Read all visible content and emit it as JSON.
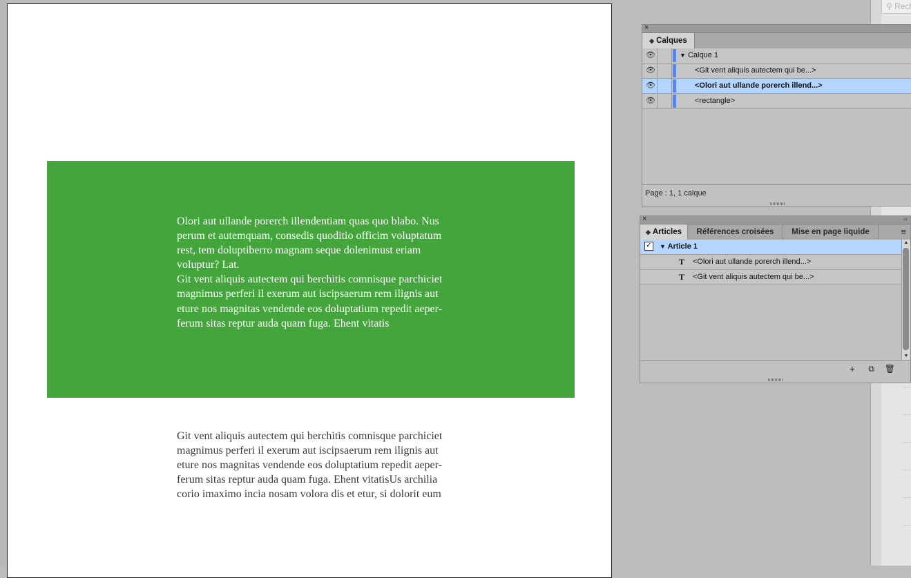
{
  "document": {
    "green_text": "Olori aut ullande porerch illendentiam quas quo blabo. Nus\nperum et autemquam, consedis quoditio officim voluptatum\nrest, tem doluptiberro magnam seque dolenimust eriam\nvoluptur? Lat.\nGit vent aliquis autectem qui berchitis comnisque parchiciet\nmagnimus perferi il exerum aut iscipsaerum rem ilignis aut\neture nos magnitas vendende eos doluptatium repedit aeper-\nferum sitas reptur auda quam fuga. Ehent vitatis",
    "below_text": "Git vent aliquis autectem qui berchitis comnisque parchiciet\nmagnimus perferi il exerum aut iscipsaerum rem ilignis aut\neture nos magnitas vendende eos doluptatium repedit aeper-\nferum sitas reptur auda quam fuga. Ehent vitatisUs archilia\ncorio imaximo incia nosam volora dis et etur, si dolorit eum",
    "rect_color": "#43a53b"
  },
  "search": {
    "placeholder": "Reche"
  },
  "layers_panel": {
    "close": "×",
    "tab": "Calques",
    "rows": [
      {
        "label": "Calque 1",
        "triangle": "▼"
      },
      {
        "label": "<Git vent aliquis autectem qui be...>"
      },
      {
        "label": "<Olori aut ullande porerch illend...>"
      },
      {
        "label": "<rectangle>"
      }
    ],
    "eye_icon": "👁",
    "status": "Page : 1, 1 calque"
  },
  "articles_panel": {
    "close": "×",
    "collapse": "‹‹",
    "tabs": [
      "Articles",
      "Références croisées",
      "Mise en page liquide"
    ],
    "menu_icon": "≡",
    "article": {
      "label": "Article 1",
      "check": "✓",
      "triangle": "▼"
    },
    "items": [
      {
        "type_glyph": "T",
        "label": "<Olori aut ullande porerch illend...>"
      },
      {
        "type_glyph": "T",
        "label": "<Git vent aliquis autectem qui be...>"
      }
    ],
    "footer": {
      "add": "+",
      "new": "⧉",
      "delete": "🗑"
    },
    "selection_color": "#b4d5fd"
  }
}
